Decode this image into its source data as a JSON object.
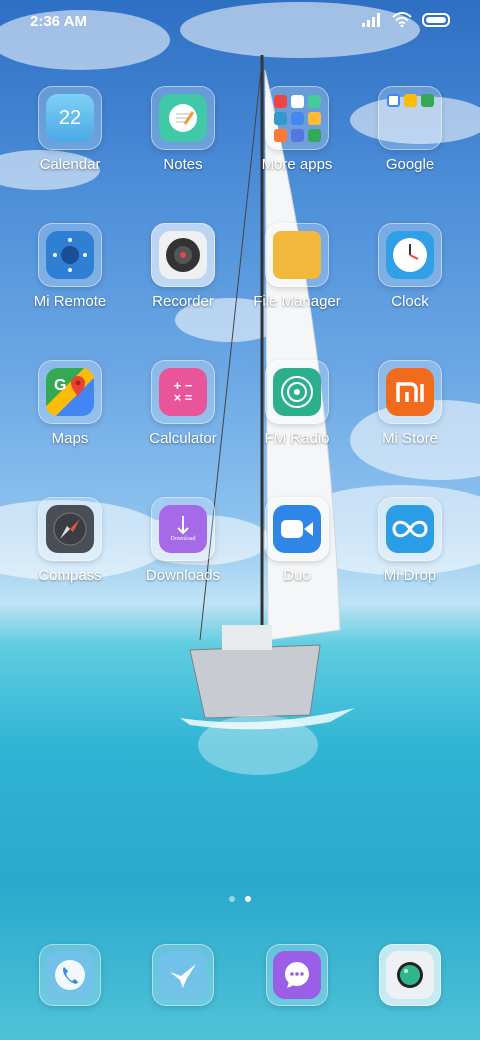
{
  "status_bar": {
    "time": "2:36 AM"
  },
  "apps": [
    {
      "label": "Calendar",
      "icon": "calendar-icon",
      "date": "22"
    },
    {
      "label": "Notes",
      "icon": "notes-icon"
    },
    {
      "label": "More apps",
      "icon": "folder-icon"
    },
    {
      "label": "Google",
      "icon": "folder-icon"
    },
    {
      "label": "Mi Remote",
      "icon": "remote-icon"
    },
    {
      "label": "Recorder",
      "icon": "recorder-icon"
    },
    {
      "label": "File Manager",
      "icon": "folder-icon"
    },
    {
      "label": "Clock",
      "icon": "clock-icon"
    },
    {
      "label": "Maps",
      "icon": "maps-icon"
    },
    {
      "label": "Calculator",
      "icon": "calculator-icon"
    },
    {
      "label": "FM Radio",
      "icon": "radio-icon"
    },
    {
      "label": "Mi Store",
      "icon": "store-icon"
    },
    {
      "label": "Compass",
      "icon": "compass-icon"
    },
    {
      "label": "Downloads",
      "icon": "download-icon",
      "badge_text": "Download"
    },
    {
      "label": "Duo",
      "icon": "video-icon"
    },
    {
      "label": "Mi Drop",
      "icon": "drop-icon"
    }
  ],
  "dock": [
    {
      "icon": "phone-icon"
    },
    {
      "icon": "bird-icon"
    },
    {
      "icon": "message-icon"
    },
    {
      "icon": "camera-icon"
    }
  ],
  "page_indicator": {
    "pages": 2,
    "current": 2
  }
}
